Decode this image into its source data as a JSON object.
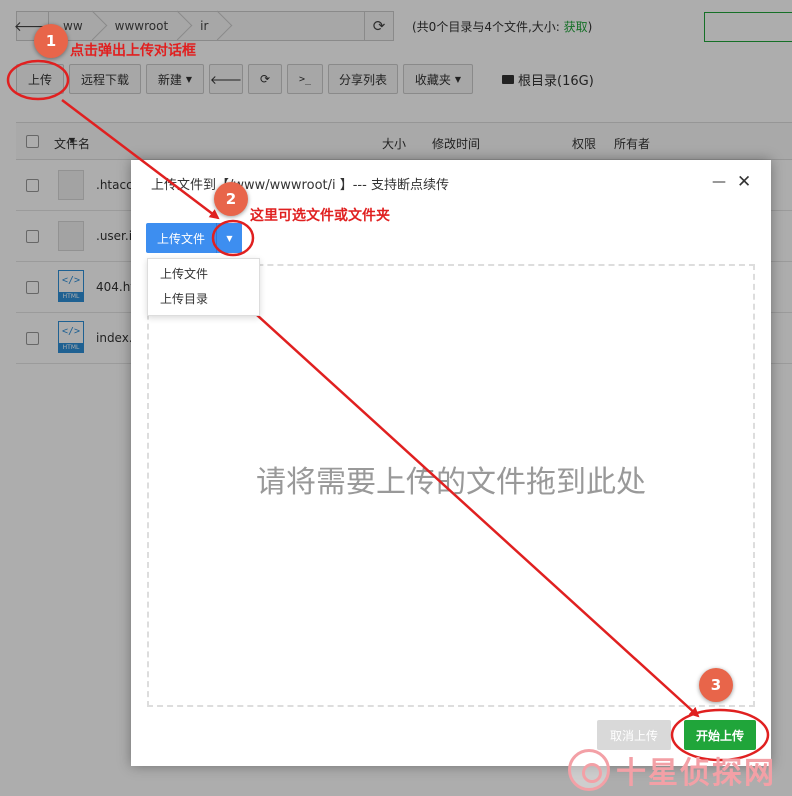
{
  "address_bar": {
    "back_glyph": "🡐",
    "crumbs": [
      "ww",
      "wwwroot",
      "ir"
    ],
    "refresh_glyph": "⟳",
    "dir_info_prefix": "(共0个目录与4个文件,大小: ",
    "dir_info_link": "获取",
    "dir_info_suffix": ")"
  },
  "toolbar": {
    "upload": "上传",
    "remote_download": "远程下载",
    "new": "新建",
    "back_glyph": "🡐",
    "refresh_glyph": "⟳",
    "terminal_glyph": ">_",
    "share_list": "分享列表",
    "favorites": "收藏夹",
    "root_dir": "根目录(16G)"
  },
  "table": {
    "headers": {
      "name": "文件名",
      "size": "大小",
      "modified": "修改时间",
      "perm": "权限",
      "owner": "所有者"
    },
    "rows": [
      {
        "name": ".htacc",
        "type": "doc"
      },
      {
        "name": ".user.i",
        "type": "doc"
      },
      {
        "name": "404.ht",
        "type": "html"
      },
      {
        "name": "index.",
        "type": "html"
      }
    ],
    "html_icon_code": "</>",
    "html_icon_tag": "HTML"
  },
  "dialog": {
    "title": "上传文件到【/www/wwwroot/i           】--- 支持断点续传",
    "minimize_glyph": "—",
    "close_glyph": "✕",
    "upload_file_button": "上传文件",
    "dropdown_caret": "▼",
    "dropdown_items": [
      "上传文件",
      "上传目录"
    ],
    "drop_text": "请将需要上传的文件拖到此处",
    "cancel_button": "取消上传",
    "start_button": "开始上传"
  },
  "annotations": {
    "step1_number": "1",
    "step1_text": "点击弹出上传对话框",
    "step2_number": "2",
    "step2_text": "这里可选文件或文件夹",
    "step3_number": "3",
    "color": "#e02020"
  },
  "watermark": {
    "text": "十星侦探网"
  },
  "colors": {
    "accent_green": "#20a53a",
    "accent_blue": "#3d8ef0",
    "annotation_red": "#e02020"
  }
}
